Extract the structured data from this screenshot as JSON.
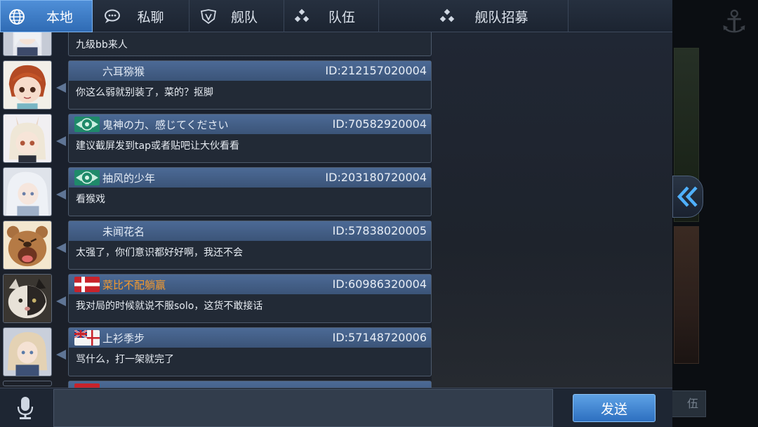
{
  "tabs": [
    {
      "label": "本地",
      "icon": "globe-icon",
      "active": true
    },
    {
      "label": "私聊",
      "icon": "speech-bubble-icon",
      "active": false
    },
    {
      "label": "舰队",
      "icon": "fleet-icon",
      "active": false
    },
    {
      "label": "队伍",
      "icon": "team-icon",
      "active": false
    },
    {
      "label": "舰队招募",
      "icon": "recruit-icon",
      "active": false
    }
  ],
  "top_partial_message": {
    "text": "九级bb来人"
  },
  "messages": [
    {
      "name": "六耳猕猴",
      "id": "ID:212157020004",
      "text": "你这么弱就别装了，菜的？抠脚",
      "badge": "none",
      "name_color": "#e5ecf6"
    },
    {
      "name": "鬼神の力、感じてください",
      "id": "ID:70582920004",
      "text": "建议截屏发到tap或者贴吧让大伙看看",
      "badge": "green-emblem",
      "name_color": "#e5ecf6"
    },
    {
      "name": "抽风的少年",
      "id": "ID:203180720004",
      "text": "看猴戏",
      "badge": "green-emblem",
      "name_color": "#e5ecf6"
    },
    {
      "name": "未闻花名",
      "id": "ID:57838020005",
      "text": "太强了，你们意识都好好啊，我还不会",
      "badge": "none",
      "name_color": "#e5ecf6"
    },
    {
      "name": "菜比不配躺赢",
      "id": "ID:60986320004",
      "text": "我对局的时候就说不服solo，这货不敢接话",
      "badge": "red-cross-flag",
      "name_color": "#f49a2e"
    },
    {
      "name": "上衫季步",
      "id": "ID:57148720006",
      "text": "骂什么，打一架就完了",
      "badge": "union-flag",
      "name_color": "#e5ecf6"
    }
  ],
  "input": {
    "value": "",
    "placeholder": ""
  },
  "send_label": "发送",
  "background_button_label": "伍",
  "colors": {
    "accent_tab": "#3b7cc8",
    "bubble_header": "#4c6a96",
    "orange_name": "#f49a2e",
    "send_button": "#3f88d6"
  }
}
